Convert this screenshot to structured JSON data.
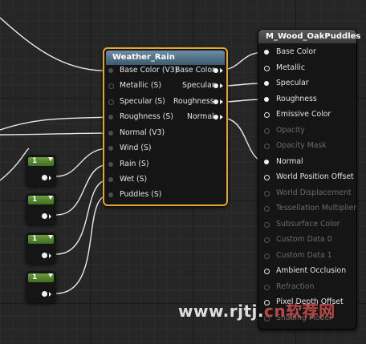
{
  "function_node": {
    "title": "Weather_Rain",
    "inputs": [
      "Base Color (V3)",
      "Metallic (S)",
      "Specular (S)",
      "Roughness (S)",
      "Normal (V3)",
      "Wind (S)",
      "Rain (S)",
      "Wet (S)",
      "Puddles (S)"
    ],
    "outputs": [
      "Base Color",
      "Specular",
      "Roughness",
      "Normal"
    ]
  },
  "material_node": {
    "title": "M_Wood_OakPuddles",
    "pins": [
      {
        "label": "Base Color",
        "enabled": true
      },
      {
        "label": "Metallic",
        "enabled": true
      },
      {
        "label": "Specular",
        "enabled": true
      },
      {
        "label": "Roughness",
        "enabled": true
      },
      {
        "label": "Emissive Color",
        "enabled": true
      },
      {
        "label": "Opacity",
        "enabled": false
      },
      {
        "label": "Opacity Mask",
        "enabled": false
      },
      {
        "label": "Normal",
        "enabled": true
      },
      {
        "label": "World Position Offset",
        "enabled": true
      },
      {
        "label": "World Displacement",
        "enabled": false
      },
      {
        "label": "Tessellation Multiplier",
        "enabled": false
      },
      {
        "label": "Subsurface Color",
        "enabled": false
      },
      {
        "label": "Custom Data 0",
        "enabled": false
      },
      {
        "label": "Custom Data 1",
        "enabled": false
      },
      {
        "label": "Ambient Occlusion",
        "enabled": true
      },
      {
        "label": "Refraction",
        "enabled": false
      },
      {
        "label": "Pixel Depth Offset",
        "enabled": true
      },
      {
        "label": "Shading Model",
        "enabled": false
      }
    ]
  },
  "constants": [
    {
      "value": "1"
    },
    {
      "value": "1"
    },
    {
      "value": "1"
    },
    {
      "value": "1"
    }
  ],
  "watermark": {
    "text": "www.rjtj.",
    "cn": "cn软荐网"
  },
  "colors": {
    "highlight": "#e4a62a",
    "function_header": "#6b8fa6",
    "constant_header": "#6c9e40",
    "wire": "#e8e8e8"
  }
}
